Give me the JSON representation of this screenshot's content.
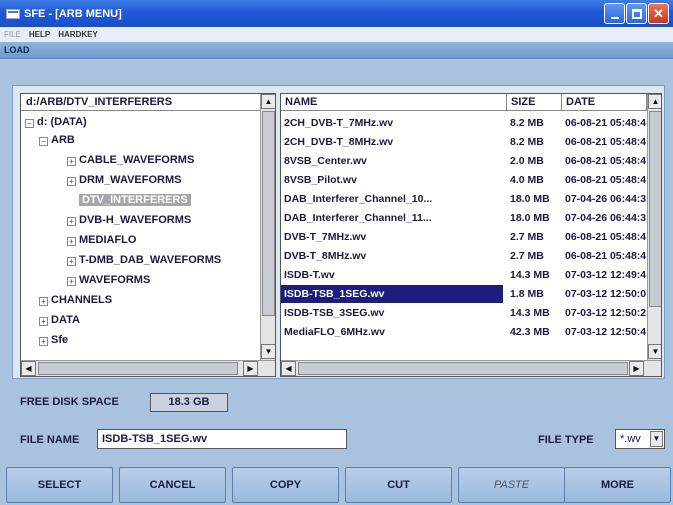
{
  "window": {
    "title": "SFE - [ARB MENU]"
  },
  "menu": {
    "items": [
      "FILE",
      "HELP",
      "HARDKEY"
    ]
  },
  "section": {
    "title": "LOAD"
  },
  "tree": {
    "header": "d:/ARB/DTV_INTERFERERS",
    "nodes": [
      {
        "label": "d: (DATA)",
        "expander": "−"
      },
      {
        "label": "ARB",
        "expander": "−"
      },
      {
        "label": "CABLE_WAVEFORMS",
        "expander": "+"
      },
      {
        "label": "DRM_WAVEFORMS",
        "expander": "+"
      },
      {
        "label": "DTV_INTERFERERS",
        "expander": ""
      },
      {
        "label": "DVB-H_WAVEFORMS",
        "expander": "+"
      },
      {
        "label": "MEDIAFLO",
        "expander": "+"
      },
      {
        "label": "T-DMB_DAB_WAVEFORMS",
        "expander": "+"
      },
      {
        "label": "WAVEFORMS",
        "expander": "+"
      },
      {
        "label": "CHANNELS",
        "expander": "+"
      },
      {
        "label": "DATA",
        "expander": "+"
      },
      {
        "label": "Sfe",
        "expander": "+"
      }
    ]
  },
  "files": {
    "columns": [
      "NAME",
      "SIZE",
      "DATE"
    ],
    "rows": [
      {
        "name": "2CH_DVB-T_7MHz.wv",
        "size": "8.2 MB",
        "date": "06-08-21 05:48:4"
      },
      {
        "name": "2CH_DVB-T_8MHz.wv",
        "size": "8.2 MB",
        "date": "06-08-21 05:48:4"
      },
      {
        "name": "8VSB_Center.wv",
        "size": "2.0 MB",
        "date": "06-08-21 05:48:4"
      },
      {
        "name": "8VSB_Pilot.wv",
        "size": "4.0 MB",
        "date": "06-08-21 05:48:4"
      },
      {
        "name": "DAB_Interferer_Channel_10...",
        "size": "18.0 MB",
        "date": "07-04-26 06:44:3"
      },
      {
        "name": "DAB_Interferer_Channel_11...",
        "size": "18.0 MB",
        "date": "07-04-26 06:44:3"
      },
      {
        "name": "DVB-T_7MHz.wv",
        "size": "2.7 MB",
        "date": "06-08-21 05:48:4"
      },
      {
        "name": "DVB-T_8MHz.wv",
        "size": "2.7 MB",
        "date": "06-08-21 05:48:4"
      },
      {
        "name": "ISDB-T.wv",
        "size": "14.3 MB",
        "date": "07-03-12 12:49:4"
      },
      {
        "name": "ISDB-TSB_1SEG.wv",
        "size": "1.8 MB",
        "date": "07-03-12 12:50:0"
      },
      {
        "name": "ISDB-TSB_3SEG.wv",
        "size": "14.3 MB",
        "date": "07-03-12 12:50:2"
      },
      {
        "name": "MediaFLO_6MHz.wv",
        "size": "42.3 MB",
        "date": "07-03-12 12:50:4"
      }
    ]
  },
  "disk": {
    "label": "FREE DISK SPACE",
    "value": "18.3 GB"
  },
  "filename": {
    "label": "FILE NAME",
    "value": "ISDB-TSB_1SEG.wv"
  },
  "filetype": {
    "label": "FILE TYPE",
    "value": "*.wv"
  },
  "buttons": [
    "SELECT",
    "CANCEL",
    "COPY",
    "CUT",
    "PASTE",
    "MORE"
  ],
  "colors": {
    "title": "#2159d8",
    "selection": "#1b1e7e",
    "button": "#a9c3df"
  }
}
